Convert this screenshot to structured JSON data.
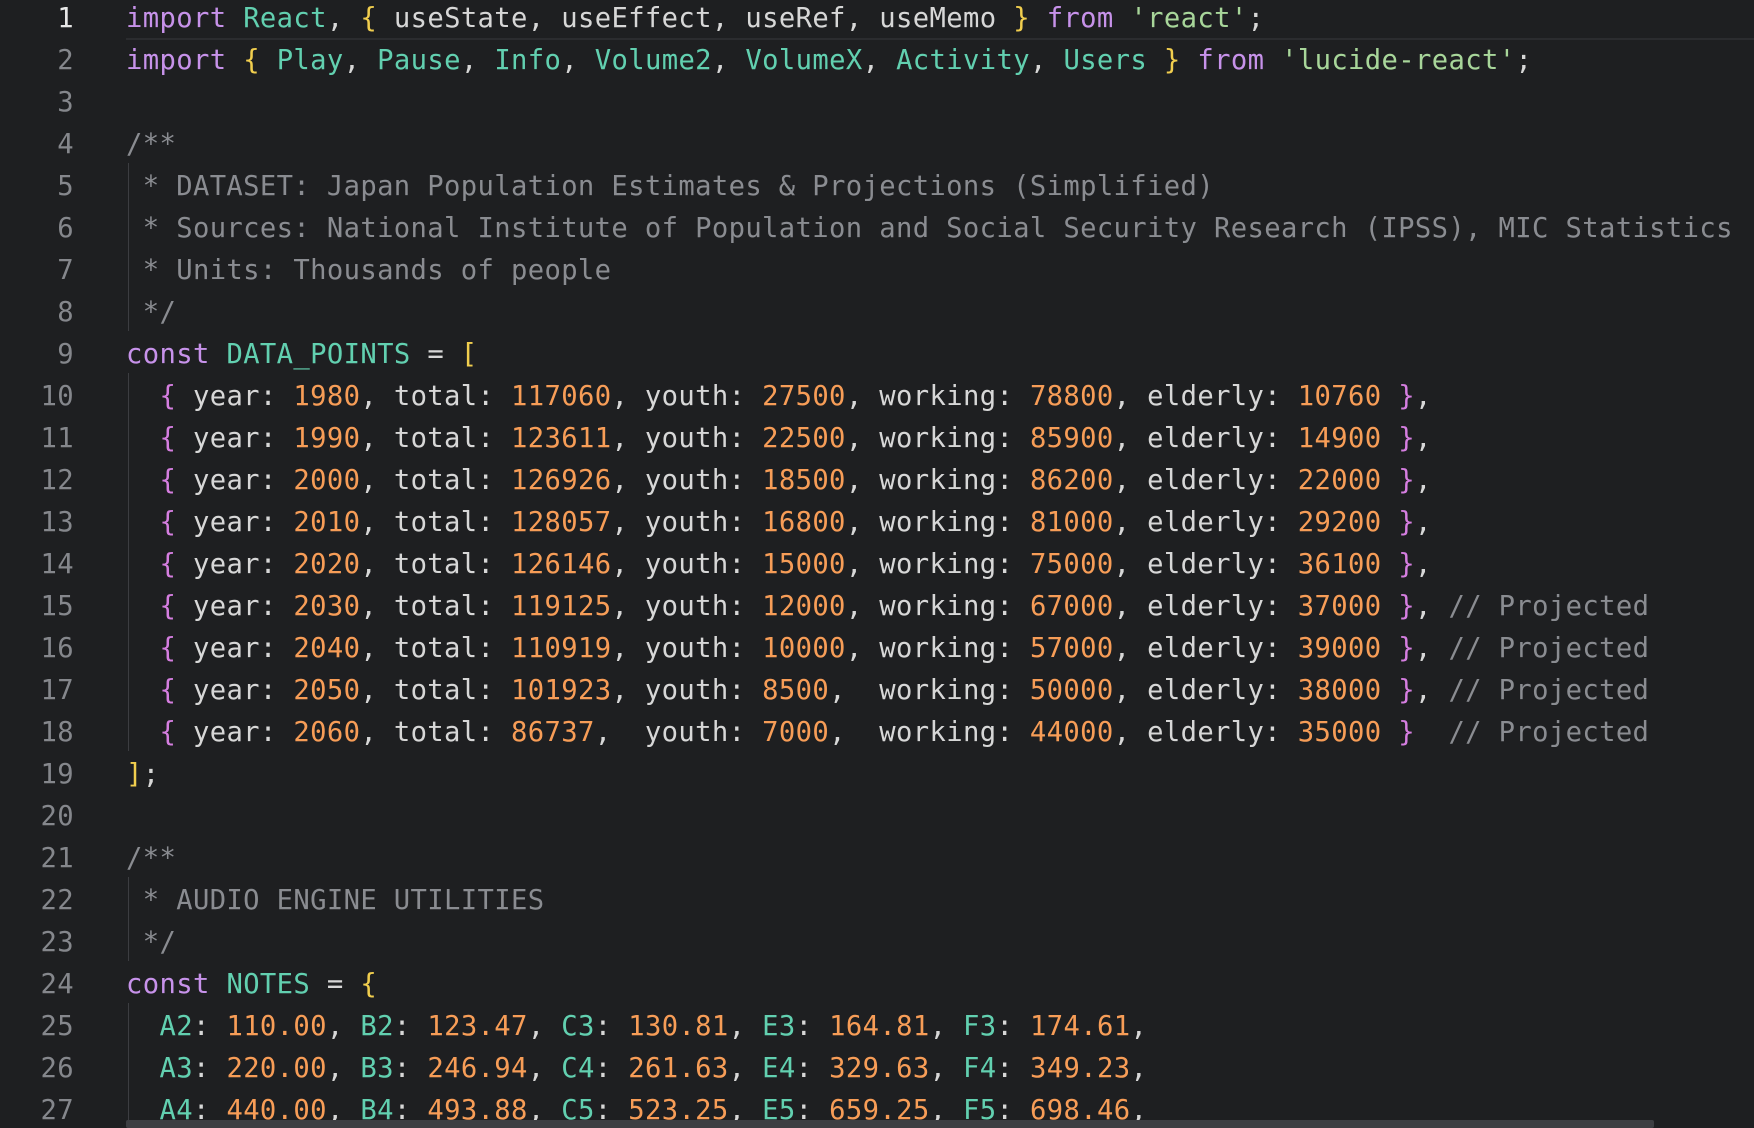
{
  "lines": [
    {
      "n": "1",
      "current": true,
      "t": [
        [
          "kw",
          "import"
        ],
        [
          "pl",
          " "
        ],
        [
          "id",
          "React"
        ],
        [
          "pl",
          ", "
        ],
        [
          "br1",
          "{"
        ],
        [
          "pl",
          " useState, useEffect, useRef, useMemo "
        ],
        [
          "br1",
          "}"
        ],
        [
          "pl",
          " "
        ],
        [
          "kw",
          "from"
        ],
        [
          "pl",
          " "
        ],
        [
          "str",
          "'react'"
        ],
        [
          "pl",
          ";"
        ]
      ]
    },
    {
      "n": "2",
      "t": [
        [
          "kw",
          "import"
        ],
        [
          "pl",
          " "
        ],
        [
          "br1",
          "{"
        ],
        [
          "pl",
          " "
        ],
        [
          "id",
          "Play"
        ],
        [
          "pl",
          ", "
        ],
        [
          "id",
          "Pause"
        ],
        [
          "pl",
          ", "
        ],
        [
          "id",
          "Info"
        ],
        [
          "pl",
          ", "
        ],
        [
          "id",
          "Volume2"
        ],
        [
          "pl",
          ", "
        ],
        [
          "id",
          "VolumeX"
        ],
        [
          "pl",
          ", "
        ],
        [
          "id",
          "Activity"
        ],
        [
          "pl",
          ", "
        ],
        [
          "id",
          "Users"
        ],
        [
          "pl",
          " "
        ],
        [
          "br1",
          "}"
        ],
        [
          "pl",
          " "
        ],
        [
          "kw",
          "from"
        ],
        [
          "pl",
          " "
        ],
        [
          "str",
          "'lucide-react'"
        ],
        [
          "pl",
          ";"
        ]
      ]
    },
    {
      "n": "3",
      "t": []
    },
    {
      "n": "4",
      "t": [
        [
          "com",
          "/**"
        ]
      ]
    },
    {
      "n": "5",
      "t": [
        [
          "com",
          " * DATASET: Japan Population Estimates & Projections (Simplified)"
        ]
      ]
    },
    {
      "n": "6",
      "t": [
        [
          "com",
          " * Sources: National Institute of Population and Social Security Research (IPSS), MIC Statistics"
        ]
      ]
    },
    {
      "n": "7",
      "t": [
        [
          "com",
          " * Units: Thousands of people"
        ]
      ]
    },
    {
      "n": "8",
      "t": [
        [
          "com",
          " */"
        ]
      ]
    },
    {
      "n": "9",
      "t": [
        [
          "kw",
          "const"
        ],
        [
          "pl",
          " "
        ],
        [
          "id",
          "DATA_POINTS"
        ],
        [
          "pl",
          " = "
        ],
        [
          "br1",
          "["
        ]
      ]
    },
    {
      "n": "10",
      "t": [
        [
          "pl",
          "  "
        ],
        [
          "br2",
          "{"
        ],
        [
          "pl",
          " year: "
        ],
        [
          "num",
          "1980"
        ],
        [
          "pl",
          ", total: "
        ],
        [
          "num",
          "117060"
        ],
        [
          "pl",
          ", youth: "
        ],
        [
          "num",
          "27500"
        ],
        [
          "pl",
          ", working: "
        ],
        [
          "num",
          "78800"
        ],
        [
          "pl",
          ", elderly: "
        ],
        [
          "num",
          "10760"
        ],
        [
          "pl",
          " "
        ],
        [
          "br2",
          "}"
        ],
        [
          "pl",
          ","
        ]
      ]
    },
    {
      "n": "11",
      "t": [
        [
          "pl",
          "  "
        ],
        [
          "br2",
          "{"
        ],
        [
          "pl",
          " year: "
        ],
        [
          "num",
          "1990"
        ],
        [
          "pl",
          ", total: "
        ],
        [
          "num",
          "123611"
        ],
        [
          "pl",
          ", youth: "
        ],
        [
          "num",
          "22500"
        ],
        [
          "pl",
          ", working: "
        ],
        [
          "num",
          "85900"
        ],
        [
          "pl",
          ", elderly: "
        ],
        [
          "num",
          "14900"
        ],
        [
          "pl",
          " "
        ],
        [
          "br2",
          "}"
        ],
        [
          "pl",
          ","
        ]
      ]
    },
    {
      "n": "12",
      "t": [
        [
          "pl",
          "  "
        ],
        [
          "br2",
          "{"
        ],
        [
          "pl",
          " year: "
        ],
        [
          "num",
          "2000"
        ],
        [
          "pl",
          ", total: "
        ],
        [
          "num",
          "126926"
        ],
        [
          "pl",
          ", youth: "
        ],
        [
          "num",
          "18500"
        ],
        [
          "pl",
          ", working: "
        ],
        [
          "num",
          "86200"
        ],
        [
          "pl",
          ", elderly: "
        ],
        [
          "num",
          "22000"
        ],
        [
          "pl",
          " "
        ],
        [
          "br2",
          "}"
        ],
        [
          "pl",
          ","
        ]
      ]
    },
    {
      "n": "13",
      "t": [
        [
          "pl",
          "  "
        ],
        [
          "br2",
          "{"
        ],
        [
          "pl",
          " year: "
        ],
        [
          "num",
          "2010"
        ],
        [
          "pl",
          ", total: "
        ],
        [
          "num",
          "128057"
        ],
        [
          "pl",
          ", youth: "
        ],
        [
          "num",
          "16800"
        ],
        [
          "pl",
          ", working: "
        ],
        [
          "num",
          "81000"
        ],
        [
          "pl",
          ", elderly: "
        ],
        [
          "num",
          "29200"
        ],
        [
          "pl",
          " "
        ],
        [
          "br2",
          "}"
        ],
        [
          "pl",
          ","
        ]
      ]
    },
    {
      "n": "14",
      "t": [
        [
          "pl",
          "  "
        ],
        [
          "br2",
          "{"
        ],
        [
          "pl",
          " year: "
        ],
        [
          "num",
          "2020"
        ],
        [
          "pl",
          ", total: "
        ],
        [
          "num",
          "126146"
        ],
        [
          "pl",
          ", youth: "
        ],
        [
          "num",
          "15000"
        ],
        [
          "pl",
          ", working: "
        ],
        [
          "num",
          "75000"
        ],
        [
          "pl",
          ", elderly: "
        ],
        [
          "num",
          "36100"
        ],
        [
          "pl",
          " "
        ],
        [
          "br2",
          "}"
        ],
        [
          "pl",
          ","
        ]
      ]
    },
    {
      "n": "15",
      "t": [
        [
          "pl",
          "  "
        ],
        [
          "br2",
          "{"
        ],
        [
          "pl",
          " year: "
        ],
        [
          "num",
          "2030"
        ],
        [
          "pl",
          ", total: "
        ],
        [
          "num",
          "119125"
        ],
        [
          "pl",
          ", youth: "
        ],
        [
          "num",
          "12000"
        ],
        [
          "pl",
          ", working: "
        ],
        [
          "num",
          "67000"
        ],
        [
          "pl",
          ", elderly: "
        ],
        [
          "num",
          "37000"
        ],
        [
          "pl",
          " "
        ],
        [
          "br2",
          "}"
        ],
        [
          "pl",
          ", "
        ],
        [
          "com",
          "// Projected"
        ]
      ]
    },
    {
      "n": "16",
      "t": [
        [
          "pl",
          "  "
        ],
        [
          "br2",
          "{"
        ],
        [
          "pl",
          " year: "
        ],
        [
          "num",
          "2040"
        ],
        [
          "pl",
          ", total: "
        ],
        [
          "num",
          "110919"
        ],
        [
          "pl",
          ", youth: "
        ],
        [
          "num",
          "10000"
        ],
        [
          "pl",
          ", working: "
        ],
        [
          "num",
          "57000"
        ],
        [
          "pl",
          ", elderly: "
        ],
        [
          "num",
          "39000"
        ],
        [
          "pl",
          " "
        ],
        [
          "br2",
          "}"
        ],
        [
          "pl",
          ", "
        ],
        [
          "com",
          "// Projected"
        ]
      ]
    },
    {
      "n": "17",
      "t": [
        [
          "pl",
          "  "
        ],
        [
          "br2",
          "{"
        ],
        [
          "pl",
          " year: "
        ],
        [
          "num",
          "2050"
        ],
        [
          "pl",
          ", total: "
        ],
        [
          "num",
          "101923"
        ],
        [
          "pl",
          ", youth: "
        ],
        [
          "num",
          "8500"
        ],
        [
          "pl",
          ",  working: "
        ],
        [
          "num",
          "50000"
        ],
        [
          "pl",
          ", elderly: "
        ],
        [
          "num",
          "38000"
        ],
        [
          "pl",
          " "
        ],
        [
          "br2",
          "}"
        ],
        [
          "pl",
          ", "
        ],
        [
          "com",
          "// Projected"
        ]
      ]
    },
    {
      "n": "18",
      "t": [
        [
          "pl",
          "  "
        ],
        [
          "br2",
          "{"
        ],
        [
          "pl",
          " year: "
        ],
        [
          "num",
          "2060"
        ],
        [
          "pl",
          ", total: "
        ],
        [
          "num",
          "86737"
        ],
        [
          "pl",
          ",  youth: "
        ],
        [
          "num",
          "7000"
        ],
        [
          "pl",
          ",  working: "
        ],
        [
          "num",
          "44000"
        ],
        [
          "pl",
          ", elderly: "
        ],
        [
          "num",
          "35000"
        ],
        [
          "pl",
          " "
        ],
        [
          "br2",
          "}"
        ],
        [
          "pl",
          "  "
        ],
        [
          "com",
          "// Projected"
        ]
      ]
    },
    {
      "n": "19",
      "t": [
        [
          "br1",
          "]"
        ],
        [
          "pl",
          ";"
        ]
      ]
    },
    {
      "n": "20",
      "t": []
    },
    {
      "n": "21",
      "t": [
        [
          "com",
          "/**"
        ]
      ]
    },
    {
      "n": "22",
      "t": [
        [
          "com",
          " * AUDIO ENGINE UTILITIES"
        ]
      ]
    },
    {
      "n": "23",
      "t": [
        [
          "com",
          " */"
        ]
      ]
    },
    {
      "n": "24",
      "t": [
        [
          "kw",
          "const"
        ],
        [
          "pl",
          " "
        ],
        [
          "id",
          "NOTES"
        ],
        [
          "pl",
          " = "
        ],
        [
          "br1",
          "{"
        ]
      ]
    },
    {
      "n": "25",
      "t": [
        [
          "pl",
          "  "
        ],
        [
          "id",
          "A2"
        ],
        [
          "pl",
          ": "
        ],
        [
          "num",
          "110.00"
        ],
        [
          "pl",
          ", "
        ],
        [
          "id",
          "B2"
        ],
        [
          "pl",
          ": "
        ],
        [
          "num",
          "123.47"
        ],
        [
          "pl",
          ", "
        ],
        [
          "id",
          "C3"
        ],
        [
          "pl",
          ": "
        ],
        [
          "num",
          "130.81"
        ],
        [
          "pl",
          ", "
        ],
        [
          "id",
          "E3"
        ],
        [
          "pl",
          ": "
        ],
        [
          "num",
          "164.81"
        ],
        [
          "pl",
          ", "
        ],
        [
          "id",
          "F3"
        ],
        [
          "pl",
          ": "
        ],
        [
          "num",
          "174.61"
        ],
        [
          "pl",
          ","
        ]
      ]
    },
    {
      "n": "26",
      "t": [
        [
          "pl",
          "  "
        ],
        [
          "id",
          "A3"
        ],
        [
          "pl",
          ": "
        ],
        [
          "num",
          "220.00"
        ],
        [
          "pl",
          ", "
        ],
        [
          "id",
          "B3"
        ],
        [
          "pl",
          ": "
        ],
        [
          "num",
          "246.94"
        ],
        [
          "pl",
          ", "
        ],
        [
          "id",
          "C4"
        ],
        [
          "pl",
          ": "
        ],
        [
          "num",
          "261.63"
        ],
        [
          "pl",
          ", "
        ],
        [
          "id",
          "E4"
        ],
        [
          "pl",
          ": "
        ],
        [
          "num",
          "329.63"
        ],
        [
          "pl",
          ", "
        ],
        [
          "id",
          "F4"
        ],
        [
          "pl",
          ": "
        ],
        [
          "num",
          "349.23"
        ],
        [
          "pl",
          ","
        ]
      ]
    },
    {
      "n": "27",
      "t": [
        [
          "pl",
          "  "
        ],
        [
          "id",
          "A4"
        ],
        [
          "pl",
          ": "
        ],
        [
          "num",
          "440.00"
        ],
        [
          "pl",
          ", "
        ],
        [
          "id",
          "B4"
        ],
        [
          "pl",
          ": "
        ],
        [
          "num",
          "493.88"
        ],
        [
          "pl",
          ", "
        ],
        [
          "id",
          "C5"
        ],
        [
          "pl",
          ": "
        ],
        [
          "num",
          "523.25"
        ],
        [
          "pl",
          ", "
        ],
        [
          "id",
          "E5"
        ],
        [
          "pl",
          ": "
        ],
        [
          "num",
          "659.25"
        ],
        [
          "pl",
          ", "
        ],
        [
          "id",
          "F5"
        ],
        [
          "pl",
          ": "
        ],
        [
          "num",
          "698.46"
        ],
        [
          "pl",
          ","
        ]
      ]
    }
  ]
}
